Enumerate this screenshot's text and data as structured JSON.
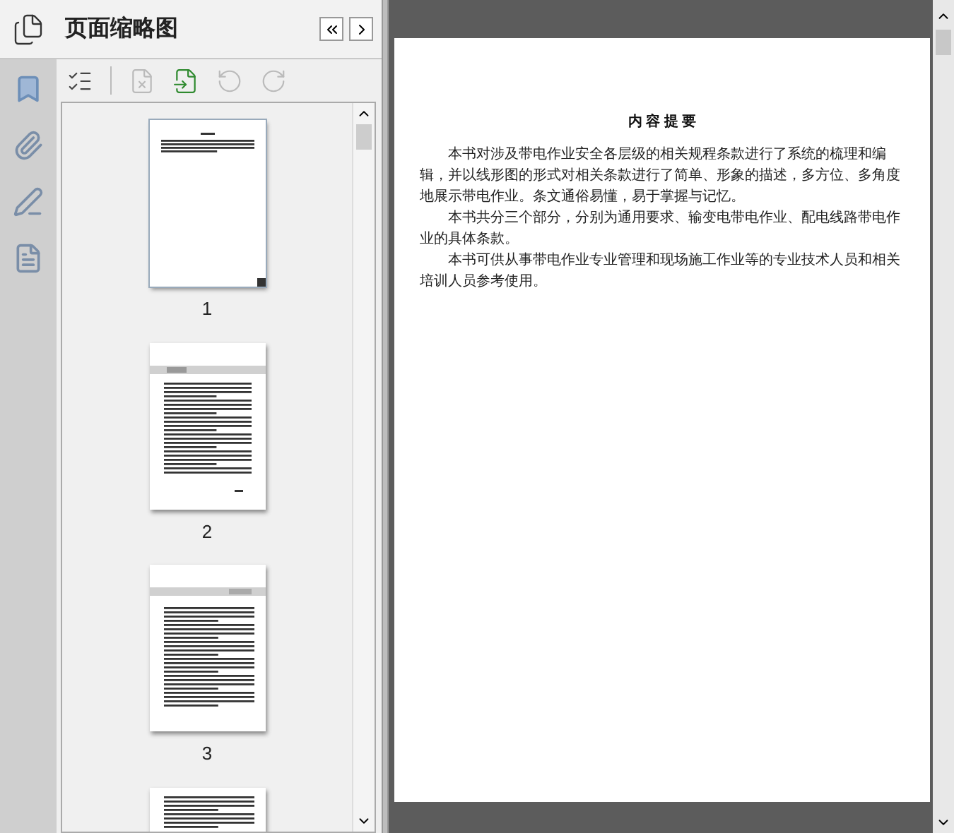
{
  "panel": {
    "title": "页面缩略图"
  },
  "toolbar": [
    {
      "kind": "options",
      "disabled": false
    },
    {
      "kind": "delete",
      "disabled": true
    },
    {
      "kind": "insert",
      "disabled": false
    },
    {
      "kind": "rotate-left",
      "disabled": true
    },
    {
      "kind": "rotate-right",
      "disabled": true
    }
  ],
  "thumbnails": [
    {
      "kind": "summary",
      "label": "1",
      "selected": true
    },
    {
      "kind": "preface",
      "label": "2",
      "selected": false
    },
    {
      "kind": "contents",
      "label": "3",
      "selected": false
    },
    {
      "kind": "contents-cont",
      "selected": false
    }
  ],
  "document": {
    "heading": "内 容 提 要",
    "paragraphs": [
      "本书对涉及带电作业安全各层级的相关规程条款进行了系统的梳理和编辑，并以线形图的形式对相关条款进行了简单、形象的描述，多方位、多角度地展示带电作业。条文通俗易懂，易于掌握与记忆。",
      "本书共分三个部分，分别为通用要求、输变电带电作业、配电线路带电作业的具体条款。",
      "本书可供从事带电作业专业管理和现场施工作业等的专业技术人员和相关培训人员参考使用。"
    ]
  }
}
